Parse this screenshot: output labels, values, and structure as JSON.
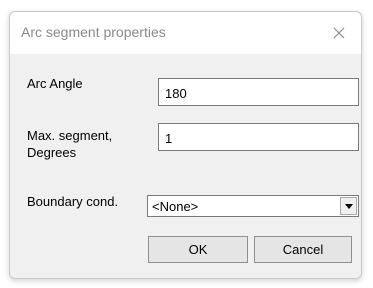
{
  "window": {
    "title": "Arc segment properties"
  },
  "fields": {
    "arc_angle": {
      "label": "Arc Angle",
      "value": "180"
    },
    "max_segment": {
      "label_line1": "Max. segment,",
      "label_line2": "Degrees",
      "value": "1"
    },
    "boundary": {
      "label": "Boundary cond.",
      "selected": "<None>"
    }
  },
  "buttons": {
    "ok": "OK",
    "cancel": "Cancel"
  },
  "icons": {
    "close": "close-icon",
    "dropdown": "chevron-down-icon"
  },
  "colors": {
    "title_text": "#8a8a8a",
    "dialog_bg": "#f0f0f0"
  }
}
